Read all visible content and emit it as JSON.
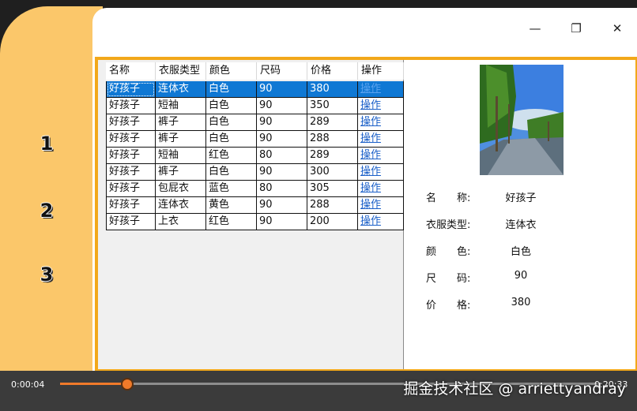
{
  "window": {
    "minimize_glyph": "—",
    "maximize_glyph": "❐",
    "close_glyph": "✕"
  },
  "side_panel": {
    "numbers": [
      "1",
      "2",
      "3"
    ]
  },
  "table": {
    "columns": [
      "名称",
      "衣服类型",
      "颜色",
      "尺码",
      "价格",
      "操作"
    ],
    "rows": [
      [
        "好孩子",
        "连体衣",
        "白色",
        "90",
        "380",
        "操作"
      ],
      [
        "好孩子",
        "短袖",
        "白色",
        "90",
        "350",
        "操作"
      ],
      [
        "好孩子",
        "裤子",
        "白色",
        "90",
        "289",
        "操作"
      ],
      [
        "好孩子",
        "裤子",
        "白色",
        "90",
        "288",
        "操作"
      ],
      [
        "好孩子",
        "短袖",
        "红色",
        "80",
        "289",
        "操作"
      ],
      [
        "好孩子",
        "裤子",
        "白色",
        "90",
        "300",
        "操作"
      ],
      [
        "好孩子",
        "包屁衣",
        "蓝色",
        "80",
        "305",
        "操作"
      ],
      [
        "好孩子",
        "连体衣",
        "黄色",
        "90",
        "288",
        "操作"
      ],
      [
        "好孩子",
        "上衣",
        "红色",
        "90",
        "200",
        "操作"
      ]
    ],
    "selected_row": 0
  },
  "detail": {
    "fields": [
      {
        "label": "名　　称:",
        "value": "好孩子"
      },
      {
        "label": "衣服类型:",
        "value": "连体衣"
      },
      {
        "label": "颜　　色:",
        "value": "白色"
      },
      {
        "label": "尺　　码:",
        "value": "90"
      },
      {
        "label": "价　　格:",
        "value": "380"
      }
    ]
  },
  "player": {
    "current_time": "0:00:04",
    "total_time": "0:20:33",
    "progress_fraction": 0.125
  },
  "watermark": "掘金技术社区 @ arriettyandray",
  "colors": {
    "accent_orange": "#f2a81a",
    "side_yellow": "#fbc76a",
    "selection_blue": "#0f78d4",
    "progress_orange": "#f07a2a"
  }
}
